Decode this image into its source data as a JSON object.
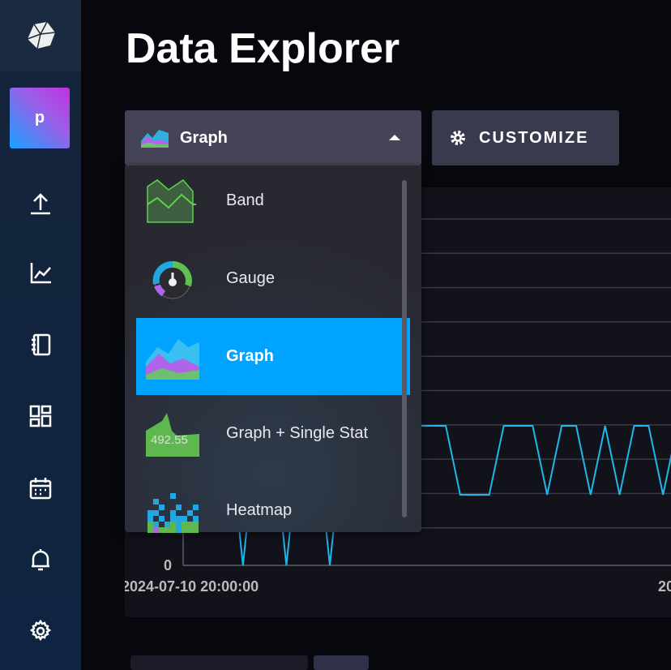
{
  "page": {
    "title": "Data Explorer"
  },
  "sidebar": {
    "avatar_letter": "p",
    "items": [
      {
        "icon": "upload-icon"
      },
      {
        "icon": "graph-icon"
      },
      {
        "icon": "notebook-icon"
      },
      {
        "icon": "dashboards-icon"
      },
      {
        "icon": "calendar-icon"
      },
      {
        "icon": "bell-icon"
      },
      {
        "icon": "gear-icon"
      }
    ]
  },
  "toolbar": {
    "selected_type": "Graph",
    "customize_label": "CUSTOMIZE"
  },
  "menu": {
    "items": [
      {
        "label": "Band"
      },
      {
        "label": "Gauge"
      },
      {
        "label": "Graph",
        "selected": true
      },
      {
        "label": "Graph + Single Stat",
        "icon_text": "492.55"
      },
      {
        "label": "Heatmap"
      }
    ]
  },
  "chart_data": {
    "type": "line",
    "color": "#22b5e8",
    "x_ticks": [
      "2024-07-10 20:00:00",
      "20"
    ],
    "y_ticks": [
      "0"
    ],
    "series": [
      {
        "values": [
          2,
          2,
          0,
          2,
          2,
          0,
          2,
          2,
          0,
          2,
          2,
          2,
          1,
          1,
          2,
          2,
          2,
          1,
          1,
          1,
          2,
          2,
          2,
          1,
          2,
          2,
          1,
          2,
          1,
          2,
          2,
          1,
          2,
          1
        ]
      }
    ]
  },
  "colors": {
    "accent": "#00a3ff",
    "line": "#22b5e8"
  }
}
